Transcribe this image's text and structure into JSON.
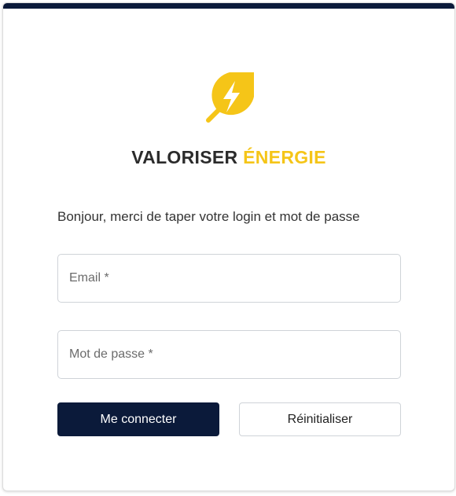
{
  "brand": {
    "name_part1": "VALORISER",
    "name_part2": "ÉNERGIE",
    "accent_color": "#f5c518",
    "dark_color": "#0b1a3a",
    "logo_icon": "lightning-leaf-icon"
  },
  "login": {
    "instructions": "Bonjour, merci de taper votre login et mot de passe",
    "email_placeholder": "Email *",
    "email_value": "",
    "password_placeholder": "Mot de passe *",
    "password_value": "",
    "submit_label": "Me connecter",
    "reset_label": "Réinitialiser"
  }
}
